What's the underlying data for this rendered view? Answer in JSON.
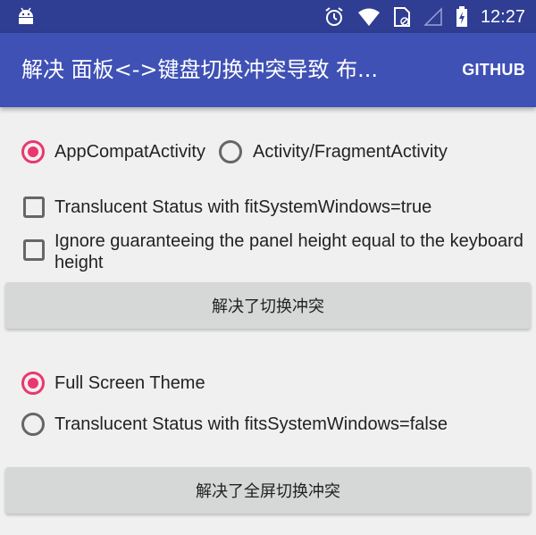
{
  "status_bar": {
    "time": "12:27",
    "icons": [
      "android-icon",
      "alarm-icon",
      "wifi-icon",
      "sim-card-blocked-icon",
      "signal-icon",
      "battery-charging-icon"
    ]
  },
  "app_bar": {
    "title": "解决 面板<->键盘切换冲突导致 布...",
    "action": "GITHUB"
  },
  "section1": {
    "radios": [
      {
        "label": "AppCompatActivity",
        "checked": true
      },
      {
        "label": "Activity/FragmentActivity",
        "checked": false
      }
    ],
    "checkboxes": [
      {
        "label": "Translucent Status with fitSystemWindows=true",
        "checked": false
      },
      {
        "label_line1": "Ignore guaranteeing the panel height equal to the keyboard",
        "label_line2": "height",
        "checked": false
      }
    ],
    "button": "解决了切换冲突"
  },
  "section2": {
    "radios": [
      {
        "label": "Full Screen Theme",
        "checked": true
      },
      {
        "label": "Translucent Status with fitsSystemWindows=false",
        "checked": false
      }
    ],
    "button": "解决了全屏切换冲突"
  },
  "colors": {
    "status_bar": "#2f3d92",
    "app_bar": "#3f51b5",
    "accent": "#e9386f",
    "background": "#f0f0f0",
    "button": "#d6d7d7"
  }
}
